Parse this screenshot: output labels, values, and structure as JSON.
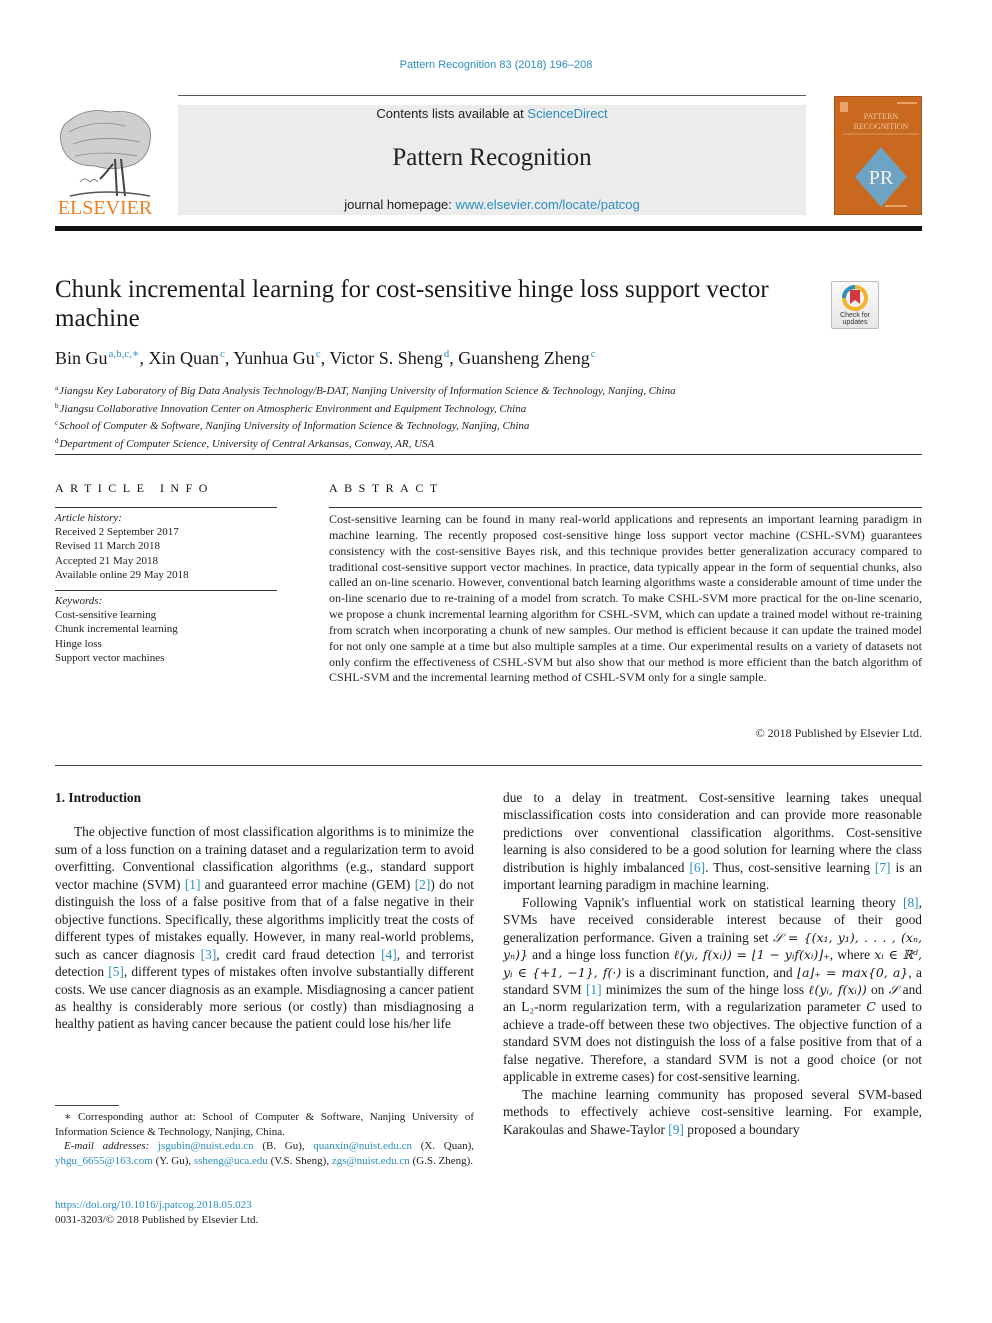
{
  "header": {
    "citation": "Pattern Recognition 83 (2018) 196–208",
    "contents_prefix": "Contents lists available at ",
    "contents_link": "ScienceDirect",
    "journal_name": "Pattern Recognition",
    "homepage_prefix": "journal homepage: ",
    "homepage_link": "www.elsevier.com/locate/patcog",
    "publisher_logo_text": "ELSEVIER",
    "cover_title_line1": "PATTERN",
    "cover_title_line2": "RECOGNITION",
    "cover_monogram": "PR",
    "check_updates_line1": "Check for",
    "check_updates_line2": "updates",
    "colors": {
      "link": "#2a8ec0",
      "elsevier_orange": "#f07f1d",
      "cover_orange": "#c8691f",
      "cover_diamond": "#6fa3c4"
    }
  },
  "article": {
    "title": "Chunk incremental learning for cost-sensitive hinge loss support vector machine",
    "authors": [
      {
        "name": "Bin Gu",
        "sup": "a,b,c,∗"
      },
      {
        "name": "Xin Quan",
        "sup": "c"
      },
      {
        "name": "Yunhua Gu",
        "sup": "c"
      },
      {
        "name": "Victor S. Sheng",
        "sup": "d"
      },
      {
        "name": "Guansheng Zheng",
        "sup": "c"
      }
    ],
    "affiliations": [
      {
        "key": "a",
        "text": "Jiangsu Key Laboratory of Big Data Analysis Technology/B-DAT, Nanjing University of Information Science & Technology, Nanjing, China"
      },
      {
        "key": "b",
        "text": "Jiangsu Collaborative Innovation Center on Atmospheric Environment and Equipment Technology, China"
      },
      {
        "key": "c",
        "text": "School of Computer & Software, Nanjing University of Information Science & Technology, Nanjing, China"
      },
      {
        "key": "d",
        "text": "Department of Computer Science, University of Central Arkansas, Conway, AR, USA"
      }
    ]
  },
  "article_info": {
    "heading": "ARTICLE INFO",
    "history_label": "Article history:",
    "history": [
      "Received 2 September 2017",
      "Revised 11 March 2018",
      "Accepted 21 May 2018",
      "Available online 29 May 2018"
    ],
    "keywords_label": "Keywords:",
    "keywords": [
      "Cost-sensitive learning",
      "Chunk incremental learning",
      "Hinge loss",
      "Support vector machines"
    ]
  },
  "abstract": {
    "heading": "ABSTRACT",
    "text": "Cost-sensitive learning can be found in many real-world applications and represents an important learning paradigm in machine learning. The recently proposed cost-sensitive hinge loss support vector machine (CSHL-SVM) guarantees consistency with the cost-sensitive Bayes risk, and this technique provides better generalization accuracy compared to traditional cost-sensitive support vector machines. In practice, data typically appear in the form of sequential chunks, also called an on-line scenario. However, conventional batch learning algorithms waste a considerable amount of time under the on-line scenario due to re-training of a model from scratch. To make CSHL-SVM more practical for the on-line scenario, we propose a chunk incremental learning algorithm for CSHL-SVM, which can update a trained model without re-training from scratch when incorporating a chunk of new samples. Our method is efficient because it can update the trained model for not only one sample at a time but also multiple samples at a time. Our experimental results on a variety of datasets not only confirm the effectiveness of CSHL-SVM but also show that our method is more efficient than the batch algorithm of CSHL-SVM and the incremental learning method of CSHL-SVM only for a single sample.",
    "copyright": "© 2018 Published by Elsevier Ltd."
  },
  "body": {
    "section_heading": "1.  Introduction",
    "p1": [
      {
        "t": "The objective function of most classification algorithms is to minimize the sum of a loss function on a training dataset and a regularization term to avoid overfitting. Conventional classification algorithms (e.g., standard support vector machine (SVM) "
      },
      {
        "ref": "[1]"
      },
      {
        "t": " and guaranteed error machine (GEM) "
      },
      {
        "ref": "[2]"
      },
      {
        "t": ") do not distinguish the loss of a false positive from that of a false negative in their objective functions. Specifically, these algorithms implicitly treat the costs of different types of mistakes equally. However, in many real-world problems, such as cancer diagnosis "
      },
      {
        "ref": "[3]"
      },
      {
        "t": ", credit card fraud detection "
      },
      {
        "ref": "[4]"
      },
      {
        "t": ", and terrorist detection "
      },
      {
        "ref": "[5]"
      },
      {
        "t": ", different types of mistakes often involve substantially different costs. We use cancer diagnosis as an example. Misdiagnosing a cancer patient as healthy is considerably more serious (or costly) than misdiagnosing a healthy patient as having cancer because the patient could lose his/her life "
      }
    ],
    "p1_cont": [
      {
        "t": "due to a delay in treatment. Cost-sensitive learning takes unequal misclassification costs into consideration and can provide more reasonable predictions over conventional classification algorithms. Cost-sensitive learning is also considered to be a good solution for learning where the class distribution is highly imbalanced "
      },
      {
        "ref": "[6]"
      },
      {
        "t": ". Thus, cost-sensitive learning "
      },
      {
        "ref": "[7]"
      },
      {
        "t": " is an important learning paradigm in machine learning."
      }
    ],
    "p2": [
      {
        "t": "Following Vapnik's influential work on statistical learning theory "
      },
      {
        "ref": "[8]"
      },
      {
        "t": ", SVMs have received considerable interest because of their good generalization performance. Given a training set "
      },
      {
        "m": "𝒮 = {(x₁, y₁), . . . , (xₙ, yₙ)}"
      },
      {
        "t": " and a hinge loss function "
      },
      {
        "m": "ℓ(yᵢ, f(xᵢ)) = ⌊1 − yᵢf(xᵢ)⌋₊"
      },
      {
        "t": ", where "
      },
      {
        "m": "xᵢ ∈ ℝᵈ, yᵢ ∈ {+1, −1}, f(·)"
      },
      {
        "t": " is a discriminant function, and "
      },
      {
        "m": "⌊a⌋₊ = max{0, a}"
      },
      {
        "t": ", a standard SVM "
      },
      {
        "ref": "[1]"
      },
      {
        "t": " minimizes the sum of the hinge loss "
      },
      {
        "m": "ℓ(yᵢ, f(xᵢ))"
      },
      {
        "t": " on "
      },
      {
        "m": "𝒮"
      },
      {
        "t": " and an L₂-norm regularization term, with a regularization parameter "
      },
      {
        "m": "C"
      },
      {
        "t": " used to achieve a trade-off between these two objectives. The objective function of a standard SVM does not distinguish the loss of a false positive from that of a false negative. Therefore, a standard SVM is not a good choice (or not applicable in extreme cases) for cost-sensitive learning."
      }
    ],
    "p3": [
      {
        "t": "The machine learning community has proposed several SVM-based methods to effectively achieve cost-sensitive learning. For example, Karakoulas and Shawe-Taylor "
      },
      {
        "ref": "[9]"
      },
      {
        "t": " proposed a boundary"
      }
    ]
  },
  "footnotes": {
    "corresponding": "∗ Corresponding author at: School of Computer & Software, Nanjing University of Information Science & Technology, Nanjing, China.",
    "email_label": "E-mail addresses:",
    "emails": [
      {
        "addr": "jsgubin@nuist.edu.cn",
        "who": " (B. Gu), "
      },
      {
        "addr": "quanxin@nuist.edu.cn",
        "who": " (X. Quan), "
      },
      {
        "addr": "yhgu_6655@163.com",
        "who": " (Y. Gu), "
      },
      {
        "addr": "ssheng@uca.edu",
        "who": " (V.S. Sheng), "
      },
      {
        "addr": "zgs@nuist.edu.cn",
        "who": " (G.S. Zheng)."
      }
    ],
    "doi": "https://doi.org/10.1016/j.patcog.2018.05.023",
    "issn_line": "0031-3203/© 2018 Published by Elsevier Ltd."
  }
}
